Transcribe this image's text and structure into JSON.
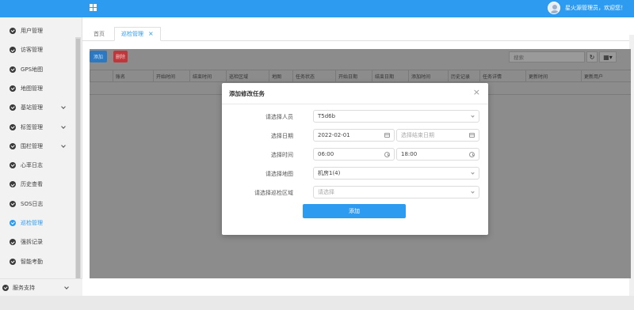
{
  "header": {
    "user_greeting": "星火源管理员，欢迎您！"
  },
  "sidebar": {
    "items": [
      {
        "label": "用户管理",
        "expandable": false,
        "active": false
      },
      {
        "label": "访客管理",
        "expandable": false,
        "active": false
      },
      {
        "label": "GPS地图",
        "expandable": false,
        "active": false
      },
      {
        "label": "地图管理",
        "expandable": false,
        "active": false
      },
      {
        "label": "基站管理",
        "expandable": true,
        "active": false
      },
      {
        "label": "标签管理",
        "expandable": true,
        "active": false
      },
      {
        "label": "围栏管理",
        "expandable": true,
        "active": false
      },
      {
        "label": "心率日志",
        "expandable": false,
        "active": false
      },
      {
        "label": "历史查看",
        "expandable": false,
        "active": false
      },
      {
        "label": "SOS日志",
        "expandable": false,
        "active": false
      },
      {
        "label": "巡检管理",
        "expandable": false,
        "active": true
      },
      {
        "label": "强拆记录",
        "expandable": false,
        "active": false
      },
      {
        "label": "智能考勤",
        "expandable": false,
        "active": false
      }
    ],
    "bottom": {
      "label": "服务支持"
    }
  },
  "tabs": {
    "home": "首页",
    "active": "巡检管理",
    "close": "×"
  },
  "toolbar": {
    "add_label": "添加",
    "delete_label": "删除",
    "search_placeholder": "搜索",
    "refresh_icon": "↻",
    "columns_icon": "▦▾"
  },
  "table": {
    "columns": [
      "",
      "账名",
      "开始时间",
      "结束时间",
      "巡检区域",
      "地图",
      "任务状态",
      "开始日期",
      "结束日期",
      "添加时间",
      "历史记录",
      "任务详情",
      "更新时间",
      "更新用户"
    ]
  },
  "modal": {
    "title": "添加修改任务",
    "close": "×",
    "person_label": "请选择人员",
    "person_value": "T5d6b",
    "date_label": "选择日期",
    "start_date": "2022-02-01",
    "end_date_placeholder": "选择结束日期",
    "time_label": "选择时间",
    "start_time": "06:00",
    "end_time": "18:00",
    "map_label": "请选择地图",
    "map_value": "机房1(4)",
    "area_label": "请选择巡检区域",
    "area_placeholder": "请选择",
    "submit": "添加"
  }
}
